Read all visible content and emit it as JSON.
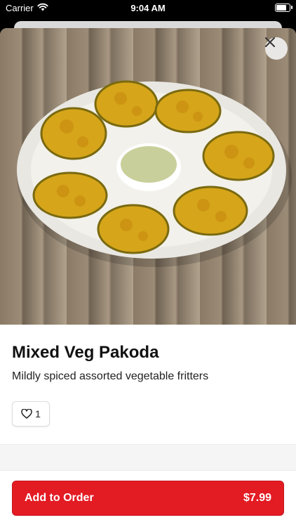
{
  "status_bar": {
    "carrier": "Carrier",
    "time": "9:04 AM",
    "battery_level": 0.95
  },
  "colors": {
    "accent": "#e31b23",
    "text": "#111111"
  },
  "icons": {
    "close": "close-icon",
    "like": "heart-icon",
    "wifi": "wifi-icon",
    "battery": "battery-icon"
  },
  "item": {
    "name": "Mixed Veg Pakoda",
    "description": "Mildly spiced assorted vegetable fritters",
    "likes": "1",
    "image_alt": "plate of vegetable pakoda fritters with green chutney"
  },
  "cta": {
    "label": "Add to Order",
    "price": "$7.99"
  }
}
